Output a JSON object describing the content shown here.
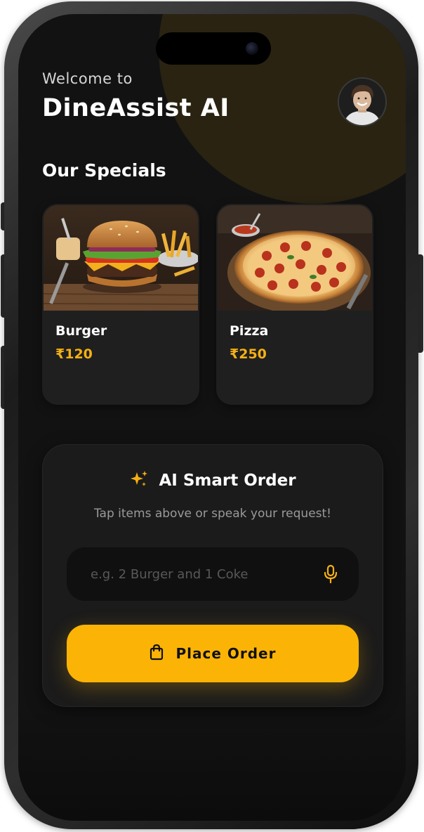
{
  "header": {
    "welcome_text": "Welcome to",
    "app_title": "DineAssist AI",
    "avatar_icon": "user-avatar"
  },
  "specials": {
    "section_title": "Our Specials",
    "items": [
      {
        "name": "Burger",
        "price": "₹120",
        "image_icon": "burger-photo"
      },
      {
        "name": "Pizza",
        "price": "₹250",
        "image_icon": "pizza-photo"
      }
    ]
  },
  "ai_order": {
    "title": "AI Smart Order",
    "title_icon": "sparkles-icon",
    "subtitle": "Tap items above or speak your request!",
    "input_placeholder": "e.g. 2 Burger and 1 Coke",
    "input_value": "",
    "mic_icon": "microphone-icon",
    "button_label": "Place Order",
    "button_icon": "shopping-bag-icon"
  },
  "colors": {
    "background": "#121212",
    "card": "#1f1f1f",
    "accent": "#fbb406",
    "price": "#f5b014",
    "text_primary": "#ffffff",
    "text_secondary": "#9a9a9a"
  }
}
